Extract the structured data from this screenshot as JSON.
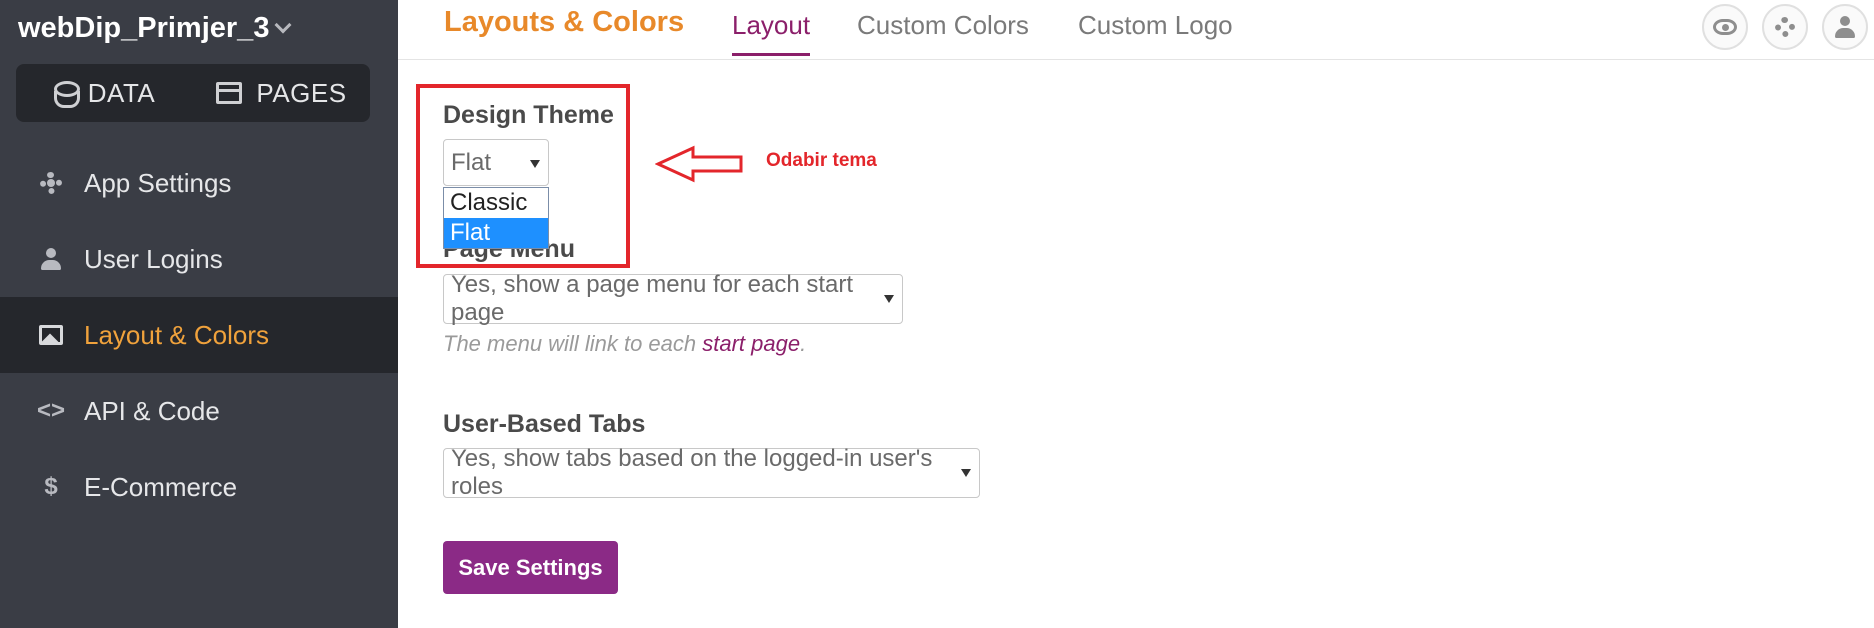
{
  "sidebar": {
    "app_title": "webDip_Primjer_3",
    "switcher": {
      "data_label": "DATA",
      "pages_label": "PAGES"
    },
    "items": [
      {
        "label": "App Settings",
        "icon": "gear-icon"
      },
      {
        "label": "User Logins",
        "icon": "user-icon"
      },
      {
        "label": "Layout & Colors",
        "icon": "image-icon",
        "active": true
      },
      {
        "label": "API & Code",
        "icon": "code-icon",
        "symbol": "<>"
      },
      {
        "label": "E-Commerce",
        "icon": "dollar-icon",
        "symbol": "$"
      }
    ]
  },
  "header": {
    "title": "Layouts & Colors",
    "tabs": [
      {
        "label": "Layout",
        "active": true
      },
      {
        "label": "Custom Colors"
      },
      {
        "label": "Custom Logo"
      }
    ]
  },
  "form": {
    "design_theme": {
      "label": "Design Theme",
      "value": "Flat",
      "options": [
        "Classic",
        "Flat"
      ]
    },
    "page_menu": {
      "label": "Page Menu",
      "value": "Yes, show a page menu for each start page",
      "help_prefix": "The menu will link to each ",
      "help_link": "start page",
      "help_suffix": "."
    },
    "user_tabs": {
      "label": "User-Based Tabs",
      "value": "Yes, show tabs based on the logged-in user's roles"
    },
    "save_label": "Save Settings"
  },
  "annotation": {
    "text": "Odabir tema",
    "color": "#e3262b"
  },
  "colors": {
    "accent_orange": "#e8892a",
    "accent_purple": "#8b1f6a",
    "sidebar_bg": "#3a3d45"
  }
}
